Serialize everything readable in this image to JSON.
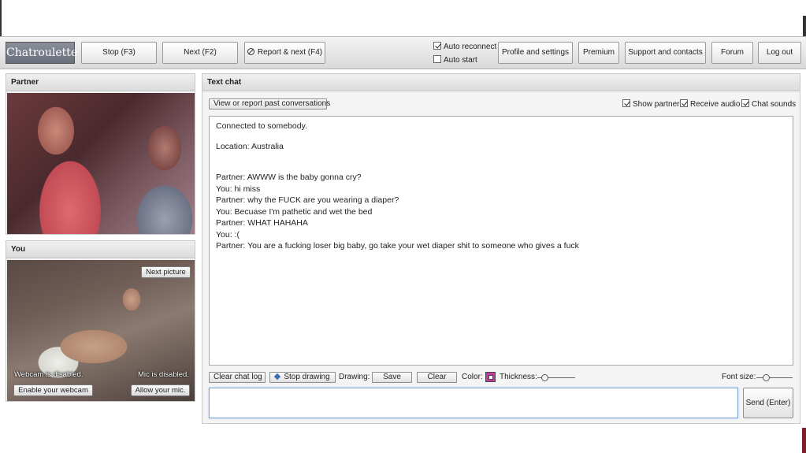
{
  "header": {
    "logo_text": "Chatroulette",
    "buttons": {
      "stop": "Stop (F3)",
      "next": "Next (F2)",
      "report_next": "Report & next (F4)",
      "profile": "Profile and settings",
      "premium": "Premium",
      "support": "Support and contacts",
      "forum": "Forum",
      "logout": "Log out"
    },
    "checkboxes": {
      "auto_reconnect": {
        "label": "Auto reconnect",
        "checked": true
      },
      "auto_start": {
        "label": "Auto start",
        "checked": false
      }
    }
  },
  "partner_panel": {
    "title": "Partner"
  },
  "you_panel": {
    "title": "You",
    "next_picture": "Next picture",
    "webcam_disabled": "Webcam is disabled.",
    "mic_disabled": "Mic is disabled.",
    "enable_webcam": "Enable your webcam",
    "allow_mic": "Allow your mic."
  },
  "chat_panel": {
    "title": "Text chat",
    "past_conversations": "View or report past conversations",
    "options": {
      "show_partner": {
        "label": "Show partner",
        "checked": true
      },
      "receive_audio": {
        "label": "Receive audio",
        "checked": true
      },
      "chat_sounds": {
        "label": "Chat sounds",
        "checked": true
      }
    },
    "log": {
      "status": "Connected to somebody.",
      "location": "Location: Australia",
      "messages": [
        "Partner: AWWW is the baby gonna cry?",
        "You: hi miss",
        "Partner: why the FUCK are you wearing a diaper?",
        "You: Becuase I'm pathetic and wet the bed",
        "Partner: WHAT HAHAHA",
        "You: :(",
        "Partner: You are a fucking loser big baby, go take your wet diaper shit to someone who gives a fuck"
      ]
    },
    "toolbar": {
      "clear_log": "Clear chat log",
      "stop_drawing": "Stop drawing",
      "drawing_label": "Drawing:",
      "save": "Save",
      "clear": "Clear",
      "color_label": "Color:",
      "color_value": "#c23aa2",
      "thickness_label": "Thickness:",
      "font_size_label": "Font size:"
    },
    "input": {
      "value": ""
    },
    "send": "Send (Enter)"
  }
}
